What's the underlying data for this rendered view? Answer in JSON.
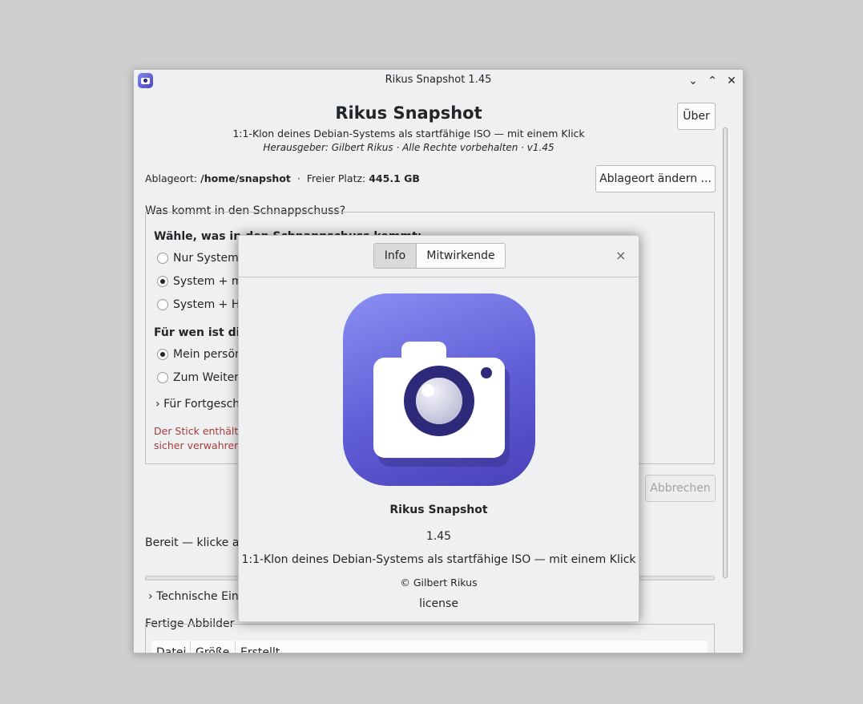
{
  "window": {
    "title": "Rikus Snapshot 1.45",
    "controls": {
      "minimize": "⌄",
      "maximize": "⌃",
      "close": "✕"
    }
  },
  "header": {
    "title": "Rikus Snapshot",
    "subtitle": "1:1-Klon deines Debian-Systems als startfähige ISO — mit einem Klick",
    "publisher": "Herausgeber: Gilbert Rikus · Alle Rechte vorbehalten · v1.45",
    "about_button": "Über"
  },
  "location": {
    "label": "Ablageort:",
    "path": "/home/snapshot",
    "separator": "·",
    "free_label": "Freier Platz:",
    "free_value": "445.1 GB",
    "change_button": "Ablageort ändern ..."
  },
  "snapshot_group": {
    "title": "Was kommt in den Schnappschuss?",
    "choose_heading": "Wähle, was in den Schnappschuss kommt:",
    "options": [
      {
        "label": "Nur System",
        "selected": false
      },
      {
        "label": "System + me",
        "selected": true
      },
      {
        "label": "System + Ho",
        "selected": false
      }
    ],
    "audience_heading": "Für wen ist die",
    "audience_options": [
      {
        "label": "Mein persön",
        "selected": true
      },
      {
        "label": "Zum Weiterg",
        "selected": false
      }
    ],
    "advanced_expander": "Für Fortgesch",
    "warning_line1": "Der Stick enthält d",
    "warning_line2": "sicher verwahren u"
  },
  "cancel_button": "Abbrechen",
  "status_text": "Bereit — klicke au",
  "progress": 0,
  "tech_expander": "Technische Ein",
  "images_group": {
    "title": "Fertige Abbilder",
    "columns": [
      "Datei",
      "Größe",
      "Erstellt"
    ]
  },
  "about_dialog": {
    "tabs": [
      {
        "label": "Info",
        "active": true
      },
      {
        "label": "Mitwirkende",
        "active": false
      }
    ],
    "close": "×",
    "app_name": "Rikus Snapshot",
    "version": "1.45",
    "description": "1:1-Klon deines Debian-Systems als startfähige ISO — mit einem Klick",
    "copyright": "© Gilbert Rikus",
    "license": "license",
    "icon": "camera-icon"
  },
  "colors": {
    "window_bg": "#eff0f1",
    "warning_text": "#a83c3c",
    "icon_gradient_start": "#8a8ff2",
    "icon_gradient_end": "#4a41b8"
  }
}
